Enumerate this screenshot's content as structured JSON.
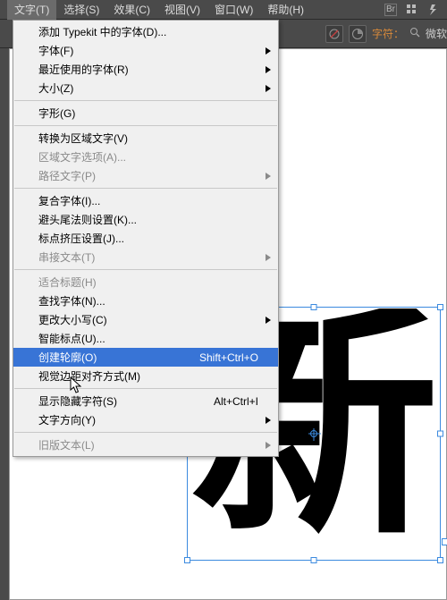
{
  "menubar": {
    "items": [
      {
        "label": "文字(T)"
      },
      {
        "label": "选择(S)"
      },
      {
        "label": "效果(C)"
      },
      {
        "label": "视图(V)"
      },
      {
        "label": "窗口(W)"
      },
      {
        "label": "帮助(H)"
      }
    ],
    "right_box": "Br"
  },
  "toolbar": {
    "char_label": "字符：",
    "font_display": "微软"
  },
  "canvas": {
    "glyph": "新"
  },
  "dropdown": {
    "items": [
      {
        "label": "添加 Typekit 中的字体(D)...",
        "submenu": false
      },
      {
        "label": "字体(F)",
        "submenu": true
      },
      {
        "label": "最近使用的字体(R)",
        "submenu": true
      },
      {
        "label": "大小(Z)",
        "submenu": true
      },
      {
        "sep": true
      },
      {
        "label": "字形(G)",
        "submenu": false
      },
      {
        "sep": true
      },
      {
        "label": "转换为区域文字(V)",
        "submenu": false
      },
      {
        "label": "区域文字选项(A)...",
        "submenu": false,
        "disabled": true
      },
      {
        "label": "路径文字(P)",
        "submenu": true,
        "disabled": true
      },
      {
        "sep": true
      },
      {
        "label": "复合字体(I)...",
        "submenu": false
      },
      {
        "label": "避头尾法则设置(K)...",
        "submenu": false
      },
      {
        "label": "标点挤压设置(J)...",
        "submenu": false
      },
      {
        "label": "串接文本(T)",
        "submenu": true,
        "disabled": true
      },
      {
        "sep": true
      },
      {
        "label": "适合标题(H)",
        "submenu": false,
        "disabled": true
      },
      {
        "label": "查找字体(N)...",
        "submenu": false
      },
      {
        "label": "更改大小写(C)",
        "submenu": true
      },
      {
        "label": "智能标点(U)...",
        "submenu": false
      },
      {
        "label": "创建轮廓(O)",
        "submenu": false,
        "shortcut": "Shift+Ctrl+O",
        "selected": true
      },
      {
        "label": "视觉边距对齐方式(M)",
        "submenu": false
      },
      {
        "sep": true
      },
      {
        "label": "显示隐藏字符(S)",
        "submenu": false,
        "shortcut": "Alt+Ctrl+I"
      },
      {
        "label": "文字方向(Y)",
        "submenu": true
      },
      {
        "sep": true
      },
      {
        "label": "旧版文本(L)",
        "submenu": true,
        "disabled": true
      }
    ]
  }
}
